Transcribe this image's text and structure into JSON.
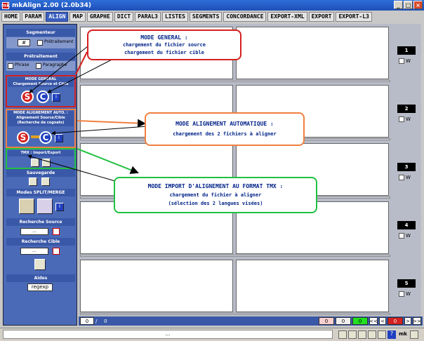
{
  "window": {
    "title": "mkAlign 2.00 (2.0b34)",
    "app_icon": "mk",
    "min": "_",
    "max": "□",
    "close": "×"
  },
  "menu": [
    "HOME",
    "PARAM",
    "ALIGN",
    "MAP",
    "GRAPHE",
    "DICT",
    "PARAL3",
    "LISTES",
    "SEGMENTS",
    "CONCORDANCE",
    "EXPORT-XML",
    "EXPORT",
    "EXPORT-L3"
  ],
  "menu_active": "ALIGN",
  "sidebar": {
    "segmenteur": "Segmenteur",
    "seg_value": "#",
    "pretraitement_cb": "Prétraitement",
    "pretraitement": "Prétraitement",
    "phrase": "Phrase",
    "paragraphe": "Paragraphe",
    "mode_general": "MODE GENERAL",
    "mode_general_sub": "Chargement Source et Cible",
    "mode_auto": "MODE ALIGNEMENT AUTO. :",
    "mode_auto_sub1": "Alignement Source/Cible",
    "mode_auto_sub2": "(Recherche de cognats)",
    "tmx": "TMX : Import/Export",
    "sauvegarde": "Sauvegarde",
    "modes_split": "Modes SPLIT/MERGE",
    "recherche_source": "Recherche Source",
    "recherche_cible": "Recherche Cible",
    "search_placeholder": "...",
    "aides": "Aides",
    "regexp": "regexp",
    "s": "S",
    "c": "C",
    "i": "i"
  },
  "callouts": {
    "general": {
      "title": "MODE GENERAL :",
      "l1": "chargement du fichier source",
      "l2": "chargement du fichier cible"
    },
    "auto": {
      "title": "MODE ALIGNEMENT AUTOMATIQUE :",
      "l1": "chargement des 2 fichiers à aligner"
    },
    "tmx": {
      "title": "MODE IMPORT D'ALIGNEMENT AU FORMAT TMX :",
      "l1": "chargement du fichier à aligner",
      "l2": "(sélection des 2 langues visées)"
    }
  },
  "rows": [
    {
      "num": "1",
      "chk": "W"
    },
    {
      "num": "2",
      "chk": "W"
    },
    {
      "num": "3",
      "chk": "W"
    },
    {
      "num": "4",
      "chk": "W"
    },
    {
      "num": "5",
      "chk": "W"
    }
  ],
  "bottom": {
    "pos": "0",
    "slash": "/",
    "total": "0",
    "c1": "0",
    "c2": "0",
    "c3": "0",
    "nav_first": "<<",
    "nav_prev": "<",
    "nav_next": ">",
    "nav_last": ">>",
    "nav_val": "0"
  },
  "status": {
    "text": "...",
    "locale": "mk",
    "question": "?"
  },
  "colors": {
    "red": "#d42020",
    "green": "#20c040",
    "orange": "#f08040",
    "blue": "#3a58a8"
  }
}
